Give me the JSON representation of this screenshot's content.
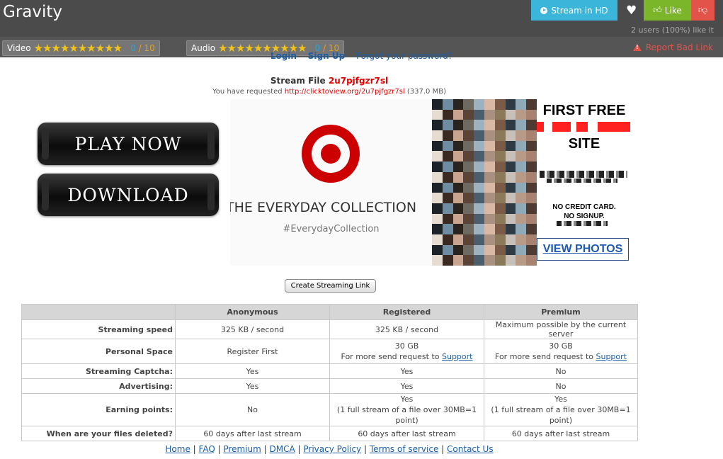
{
  "header": {
    "title": "Gravity",
    "stream_hd_label": "Stream in HD",
    "like_label": "Like",
    "likes_text": "2 users (100%) like it"
  },
  "rating": {
    "video_label": "Video",
    "video_score": "0",
    "video_den": "/ 10",
    "audio_label": "Audio",
    "audio_score": "0",
    "audio_den": "/ 10",
    "stars": "★★★★★★★★★★",
    "report_label": "Report Bad Link"
  },
  "auth": {
    "login": "Login",
    "signup": "Sign Up",
    "forgot": "Forgot your password?"
  },
  "file": {
    "stream_prefix": "Stream File",
    "code": "2u7pjfgzr7sl",
    "requested_prefix": "You have requested",
    "url": "http://clicktoview.org/2u7pjfgzr7sl",
    "size": "(337.0 MB)"
  },
  "buttons": {
    "play": "PLAY NOW",
    "download": "DOWNLOAD",
    "create_link": "Create Streaming Link"
  },
  "ad_target": {
    "text": "THE EVERYDAY COLLECTION",
    "hashtag": "#EverydayCollection"
  },
  "ad_side": {
    "title": "FIRST FREE",
    "site": "SITE",
    "no_credit": "NO CREDIT CARD.",
    "no_signup": "NO SIGNUP.",
    "view_photos": "VIEW PHOTOS"
  },
  "plans": {
    "headers": [
      "",
      "Anonymous",
      "Registered",
      "Premium"
    ],
    "rows": [
      {
        "label": "Streaming speed",
        "cells": [
          "325 KB / second",
          "325 KB / second",
          "Maximum possible by the current server"
        ]
      },
      {
        "label": "Personal Space",
        "cells": [
          "Register First",
          "30 GB",
          "30 GB"
        ],
        "sub": [
          "",
          "For more send request to",
          "For more send request to"
        ],
        "link": "Support"
      },
      {
        "label": "Streaming Captcha:",
        "cells": [
          "Yes",
          "Yes",
          "No"
        ]
      },
      {
        "label": "Advertising:",
        "cells": [
          "Yes",
          "Yes",
          "No"
        ]
      },
      {
        "label": "Earning points:",
        "cells": [
          "No",
          "Yes",
          "Yes"
        ],
        "sub": [
          "",
          "(1 full stream of a file over 30MB=1 point)",
          "(1 full stream of a file over 30MB=1 point)"
        ]
      },
      {
        "label": "When are your files deleted?",
        "cells": [
          "60 days after last stream",
          "60 days after last stream",
          "60 days after last stream"
        ]
      }
    ]
  },
  "footer": {
    "links": [
      "Home",
      "FAQ",
      "Premium",
      "DMCA",
      "Privacy Policy",
      "Terms of service",
      "Contact Us"
    ]
  }
}
